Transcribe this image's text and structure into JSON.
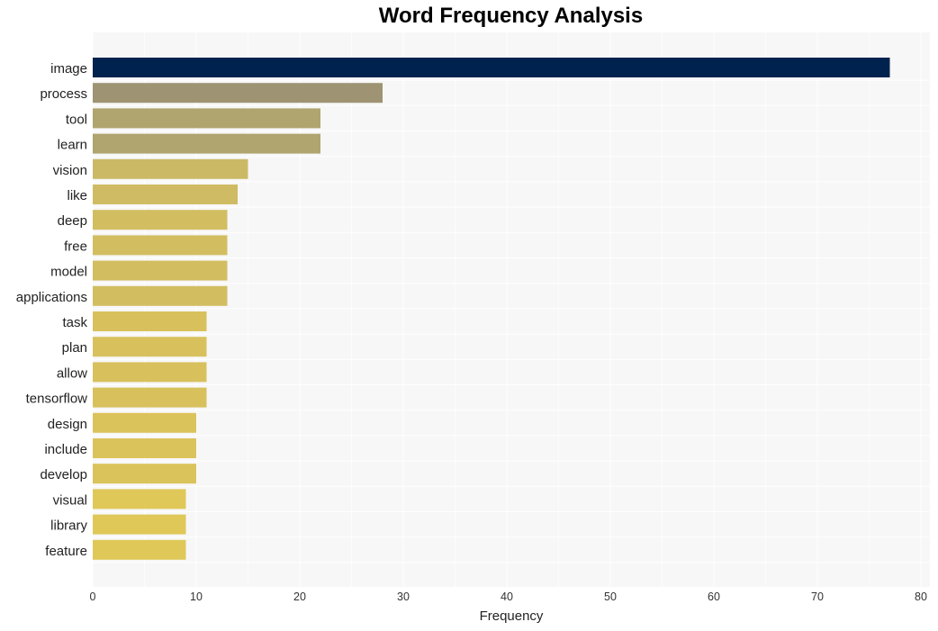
{
  "chart_data": {
    "type": "bar",
    "orientation": "horizontal",
    "title": "Word Frequency Analysis",
    "xlabel": "Frequency",
    "ylabel": "",
    "xlim": [
      0,
      80
    ],
    "xticks": [
      0,
      10,
      20,
      30,
      40,
      50,
      60,
      70,
      80
    ],
    "grid": true,
    "categories": [
      "image",
      "process",
      "tool",
      "learn",
      "vision",
      "like",
      "deep",
      "free",
      "model",
      "applications",
      "task",
      "plan",
      "allow",
      "tensorflow",
      "design",
      "include",
      "develop",
      "visual",
      "library",
      "feature"
    ],
    "values": [
      77,
      28,
      22,
      22,
      15,
      14,
      13,
      13,
      13,
      13,
      11,
      11,
      11,
      11,
      10,
      10,
      10,
      9,
      9,
      9
    ],
    "colors": [
      "#00224e",
      "#9e9373",
      "#b0a46f",
      "#b0a46f",
      "#cbb966",
      "#cfbb63",
      "#d2bd61",
      "#d2bd61",
      "#d2bd61",
      "#d2bd61",
      "#d8c15d",
      "#d8c15d",
      "#d8c15d",
      "#d8c15d",
      "#dbc35b",
      "#dbc35b",
      "#dbc35b",
      "#dfc858",
      "#dfc858",
      "#dfc858"
    ]
  }
}
